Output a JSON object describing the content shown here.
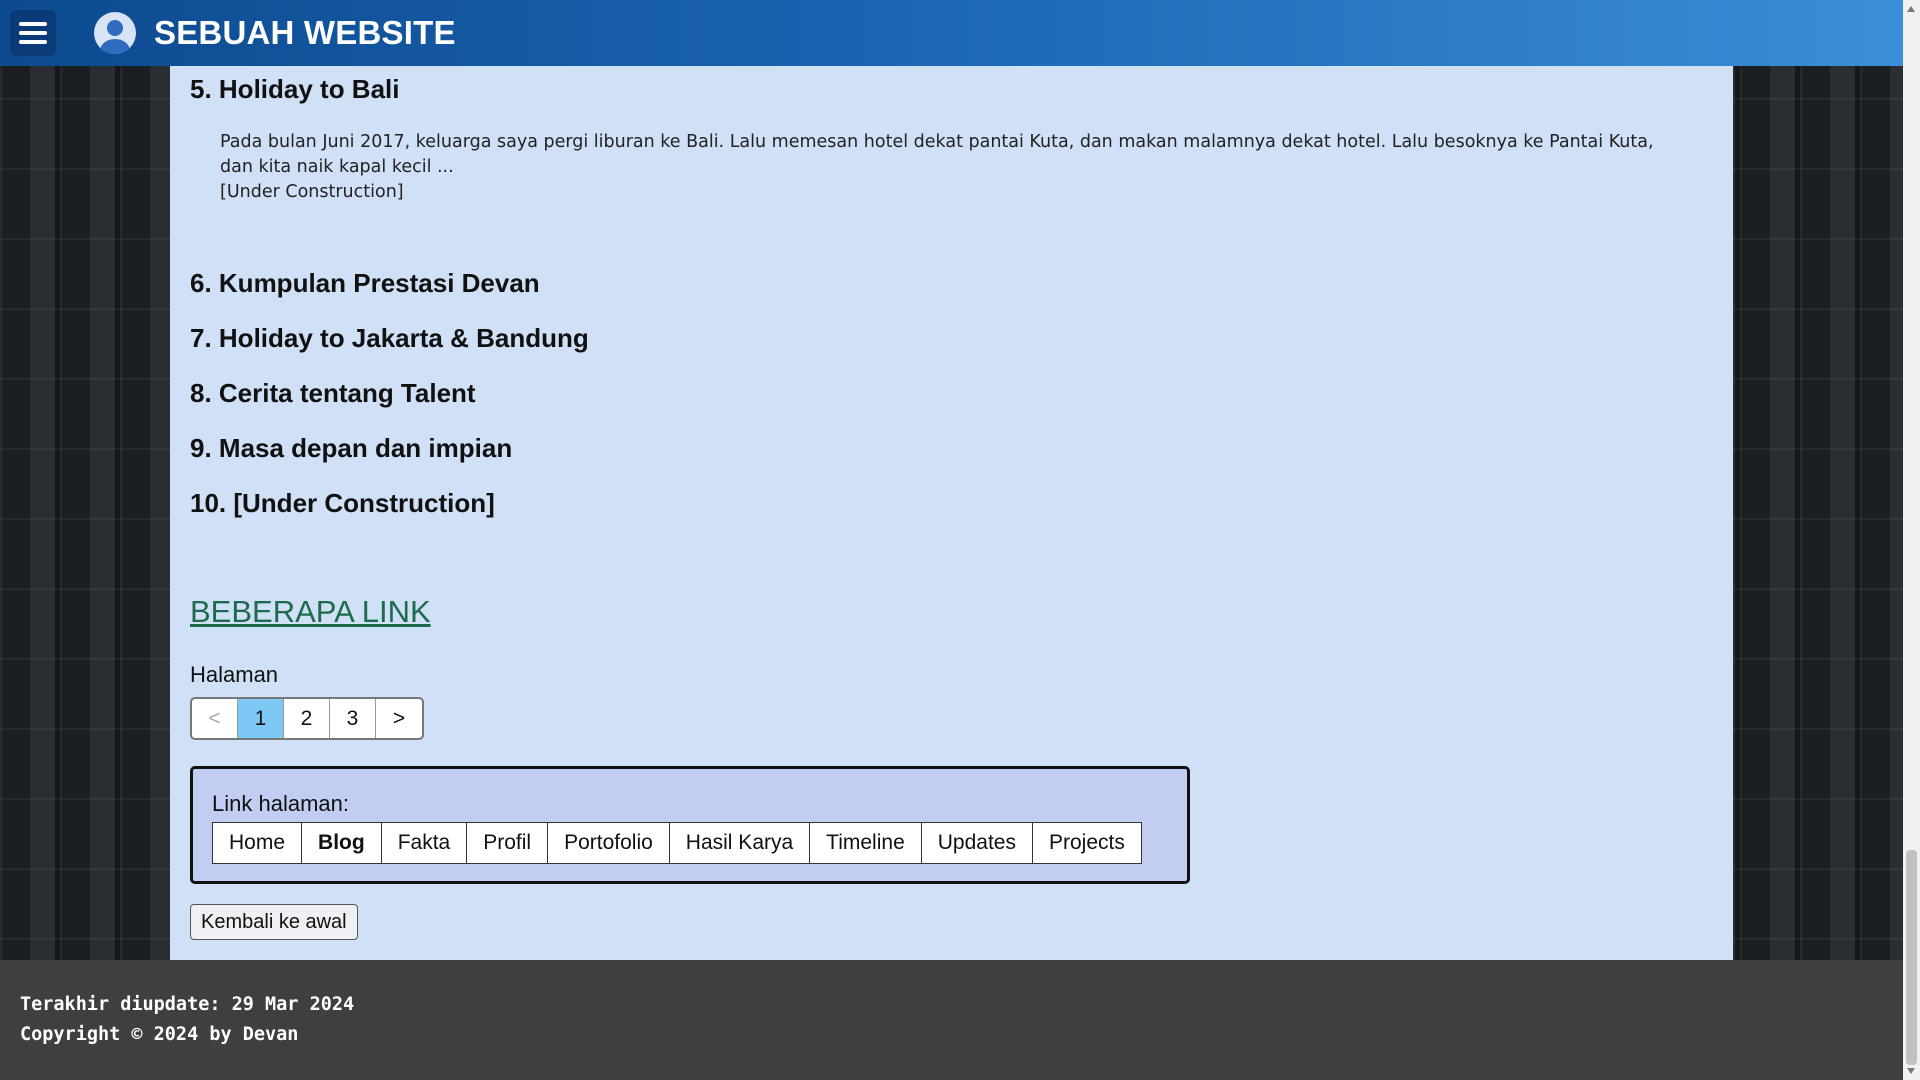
{
  "header": {
    "title": "SEBUAH WEBSITE",
    "menu_icon": "hamburger-menu-icon",
    "avatar_icon": "user-avatar-icon"
  },
  "posts": [
    {
      "title": "5. Holiday to Bali",
      "body": "Pada bulan Juni 2017, keluarga saya pergi liburan ke Bali. Lalu memesan hotel dekat pantai Kuta, dan makan malamnya dekat hotel. Lalu besoknya ke Pantai Kuta, dan kita naik kapal kecil ...",
      "note": "[Under Construction]"
    },
    {
      "title": "6. Kumpulan Prestasi Devan"
    },
    {
      "title": "7. Holiday to Jakarta & Bandung"
    },
    {
      "title": "8. Cerita tentang Talent"
    },
    {
      "title": "9. Masa depan dan impian"
    },
    {
      "title": "10. [Under Construction]"
    }
  ],
  "links_section": {
    "heading": "BEBERAPA LINK",
    "pagination_label": "Halaman",
    "pagination": {
      "prev": "<",
      "pages": [
        "1",
        "2",
        "3"
      ],
      "current": "1",
      "next": ">"
    },
    "link_box_label": "Link halaman:",
    "links": [
      "Home",
      "Blog",
      "Fakta",
      "Profil",
      "Portofolio",
      "Hasil Karya",
      "Timeline",
      "Updates",
      "Projects"
    ],
    "current_link": "Blog",
    "back_button": "Kembali ke awal"
  },
  "footer": {
    "updated": "Terakhir diupdate: 29 Mar 2024",
    "copyright": "Copyright © 2024 by Devan"
  },
  "colors": {
    "header_start": "#0d4a8f",
    "header_end": "#3a8fd6",
    "content_bg": "#cfe0f7",
    "link_color": "#1d6b4c",
    "active_page": "#7ec8f5",
    "footer_bg": "#3f3f3f"
  }
}
